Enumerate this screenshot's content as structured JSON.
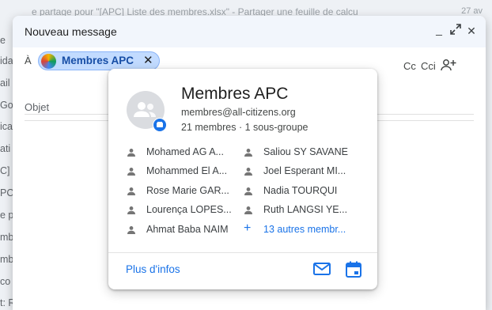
{
  "background": {
    "top_line": "e partage pour \"[APC] Liste des membres.xlsx\" - Partager une feuille de calcu",
    "date": "27 av",
    "left_fragments": [
      "e",
      "ida",
      "ail",
      "Go",
      "ica",
      "ati",
      "C]",
      "PC",
      "e p",
      "mb",
      "mb",
      "co",
      "t: R"
    ]
  },
  "compose": {
    "title": "Nouveau message",
    "minimize_label": "_",
    "expand_label": "⤢",
    "close_label": "✕",
    "to_label": "À",
    "recipient_chip": "Membres APC",
    "chip_remove": "✕",
    "cc_label": "Cc",
    "cci_label": "Cci",
    "subject_placeholder": "Objet"
  },
  "group_card": {
    "name": "Membres APC",
    "email": "membres@all-citizens.org",
    "meta": "21 membres · 1 sous-groupe",
    "members_left": [
      "Mohamed AG A...",
      "Mohammed El A...",
      "Rose Marie GAR...",
      "Lourença LOPES...",
      "Ahmat Baba NAIM"
    ],
    "members_right": [
      "Saliou SY SAVANE",
      "Joel Esperant MI...",
      "Nadia TOURQUI",
      "Ruth LANGSI YE..."
    ],
    "more_members": "13 autres membr...",
    "more_plus": "+",
    "more_info": "Plus d'infos"
  },
  "colors": {
    "accent": "#1a73e8",
    "chip_bg": "#c2dbff",
    "chip_text": "#174ea6"
  },
  "icons": [
    "group-avatar-icon",
    "google-group-badge-icon",
    "person-icon",
    "add-people-icon",
    "mail-icon",
    "calendar-icon"
  ]
}
